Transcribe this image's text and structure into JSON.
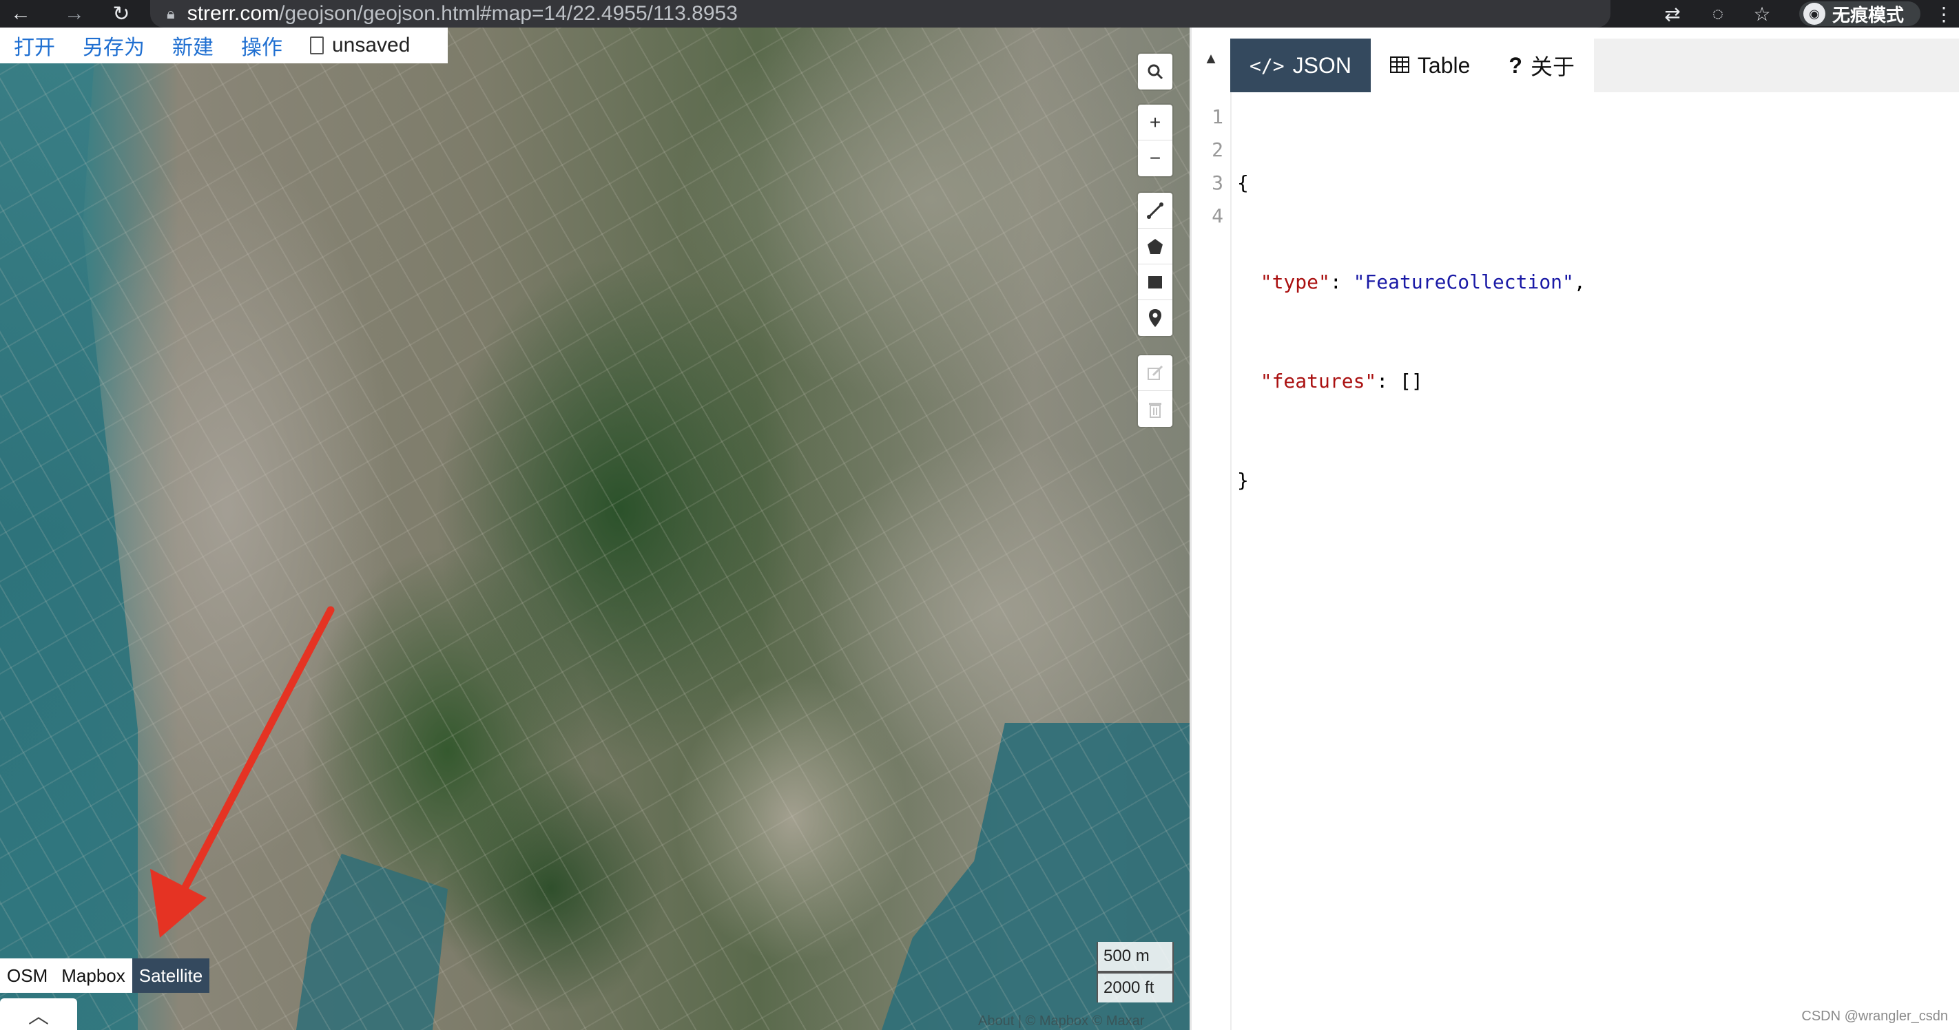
{
  "browser": {
    "url_host": "strerr.com",
    "url_path": "/geojson/geojson.html#map=14/22.4955/113.8953",
    "incognito_label": "无痕模式"
  },
  "top_menu": {
    "open": "打开",
    "save_as": "另存为",
    "new": "新建",
    "operations": "操作",
    "file_status": "unsaved"
  },
  "map_controls": {
    "zoom_in": "+",
    "zoom_out": "−"
  },
  "layers": {
    "options": [
      "OSM",
      "Mapbox",
      "Satellite"
    ],
    "selected": "Satellite"
  },
  "scale": {
    "metric": "500 m",
    "imperial": "2000 ft"
  },
  "attribution": "About | © Mapbox © Maxar",
  "panel": {
    "tabs": [
      {
        "label": "JSON",
        "icon": "code-icon",
        "active": true
      },
      {
        "label": "Table",
        "icon": "table-icon",
        "active": false
      },
      {
        "label": "关于",
        "icon": "help-icon",
        "active": false
      }
    ]
  },
  "editor": {
    "line_numbers": [
      "1",
      "2",
      "3",
      "4"
    ],
    "lines": [
      {
        "text": "{"
      },
      {
        "key": "\"type\"",
        "sep": ": ",
        "value": "\"FeatureCollection\"",
        "end": ","
      },
      {
        "key": "\"features\"",
        "sep": ": ",
        "value": "[]",
        "end": ""
      },
      {
        "text": "}"
      }
    ]
  },
  "watermark": "CSDN @wrangler_csdn",
  "colors": {
    "accent_blue": "#1f6fd1",
    "active_tab": "#34495e",
    "annotation_arrow": "#e53323"
  }
}
